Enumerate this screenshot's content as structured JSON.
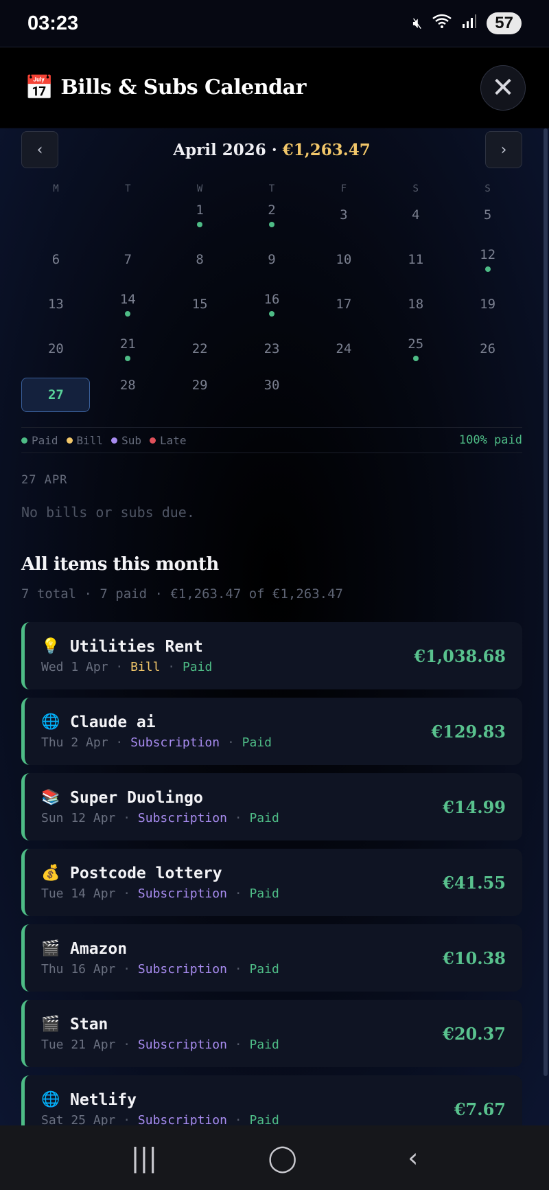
{
  "status_bar": {
    "time": "03:23",
    "battery": "57"
  },
  "header": {
    "emoji": "📅",
    "title": "Bills & Subs Calendar",
    "close_glyph": "✕"
  },
  "month_nav": {
    "prev_glyph": "‹",
    "next_glyph": "›",
    "month": "April 2026",
    "separator": " · ",
    "total": "€1,263.47"
  },
  "calendar": {
    "weekdays": [
      "M",
      "T",
      "W",
      "T",
      "F",
      "S",
      "S"
    ],
    "weeks": [
      [
        {
          "d": ""
        },
        {
          "d": ""
        },
        {
          "d": "1",
          "dot": true
        },
        {
          "d": "2",
          "dot": true
        },
        {
          "d": "3"
        },
        {
          "d": "4"
        },
        {
          "d": "5"
        }
      ],
      [
        {
          "d": "6"
        },
        {
          "d": "7"
        },
        {
          "d": "8"
        },
        {
          "d": "9"
        },
        {
          "d": "10"
        },
        {
          "d": "11"
        },
        {
          "d": "12",
          "dot": true
        }
      ],
      [
        {
          "d": "13"
        },
        {
          "d": "14",
          "dot": true
        },
        {
          "d": "15"
        },
        {
          "d": "16",
          "dot": true
        },
        {
          "d": "17"
        },
        {
          "d": "18"
        },
        {
          "d": "19"
        }
      ],
      [
        {
          "d": "20"
        },
        {
          "d": "21",
          "dot": true
        },
        {
          "d": "22"
        },
        {
          "d": "23"
        },
        {
          "d": "24"
        },
        {
          "d": "25",
          "dot": true
        },
        {
          "d": "26"
        }
      ],
      [
        {
          "d": "27",
          "today": true
        },
        {
          "d": "28"
        },
        {
          "d": "29"
        },
        {
          "d": "30"
        },
        {
          "d": ""
        },
        {
          "d": ""
        },
        {
          "d": ""
        }
      ]
    ]
  },
  "legend": {
    "items": [
      {
        "label": "Paid",
        "color": "#4ebc86"
      },
      {
        "label": "Bill",
        "color": "#f2c76a"
      },
      {
        "label": "Sub",
        "color": "#a88cf0"
      },
      {
        "label": "Late",
        "color": "#e0505a"
      }
    ],
    "paid_pct": "100% paid"
  },
  "selected_day": {
    "date": "27 APR",
    "empty_message": "No bills or subs due."
  },
  "all_items": {
    "title": "All items this month",
    "summary": "7 total · 7 paid · €1,263.47 of €1,263.47",
    "items": [
      {
        "icon": "💡",
        "name": "Utilities Rent",
        "date": "Wed 1 Apr",
        "type": "Bill",
        "status": "Paid",
        "amount": "€1,038.68"
      },
      {
        "icon": "🌐",
        "name": "Claude ai",
        "date": "Thu 2 Apr",
        "type": "Subscription",
        "status": "Paid",
        "amount": "€129.83"
      },
      {
        "icon": "📚",
        "name": "Super Duolingo",
        "date": "Sun 12 Apr",
        "type": "Subscription",
        "status": "Paid",
        "amount": "€14.99"
      },
      {
        "icon": "💰",
        "name": "Postcode lottery",
        "date": "Tue 14 Apr",
        "type": "Subscription",
        "status": "Paid",
        "amount": "€41.55"
      },
      {
        "icon": "🎬",
        "name": "Amazon",
        "date": "Thu 16 Apr",
        "type": "Subscription",
        "status": "Paid",
        "amount": "€10.38"
      },
      {
        "icon": "🎬",
        "name": "Stan",
        "date": "Tue 21 Apr",
        "type": "Subscription",
        "status": "Paid",
        "amount": "€20.37"
      },
      {
        "icon": "🌐",
        "name": "Netlify",
        "date": "Sat 25 Apr",
        "type": "Subscription",
        "status": "Paid",
        "amount": "€7.67"
      }
    ]
  },
  "nav_bar": {
    "recents_glyph": "|||",
    "home_glyph": "◯",
    "back_glyph": "‹"
  }
}
